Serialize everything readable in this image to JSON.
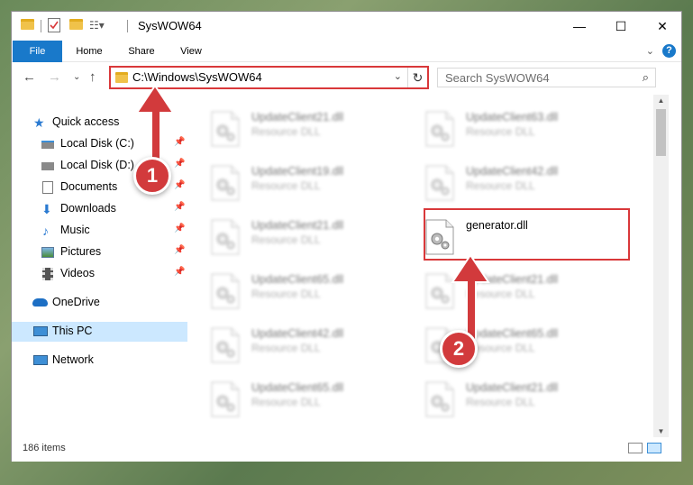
{
  "window": {
    "title": "SysWOW64",
    "controls": {
      "minimize": "—",
      "maximize": "☐",
      "close": "✕"
    }
  },
  "ribbon": {
    "tabs": [
      "File",
      "Home",
      "Share",
      "View"
    ],
    "help": "?"
  },
  "address_bar": {
    "path": "C:\\Windows\\SysWOW64",
    "refresh_icon": "↻"
  },
  "search": {
    "placeholder": "Search SysWOW64"
  },
  "nav_pane": {
    "quick_access": "Quick access",
    "pinned": [
      "Local Disk (C:)",
      "Local Disk (D:)",
      "Documents",
      "Downloads",
      "Music",
      "Pictures",
      "Videos"
    ],
    "onedrive": "OneDrive",
    "this_pc": "This PC",
    "network": "Network"
  },
  "files": [
    {
      "name": "UpdateClient21.dll",
      "type": "Resource DLL"
    },
    {
      "name": "UpdateClient63.dll",
      "type": "Resource DLL"
    },
    {
      "name": "UpdateClient19.dll",
      "type": "Resource DLL"
    },
    {
      "name": "UpdateClient42.dll",
      "type": "Resource DLL"
    },
    {
      "name": "UpdateClient21.dll",
      "type": "Resource DLL"
    },
    {
      "name": "generator.dll",
      "type": ""
    },
    {
      "name": "UpdateClient65.dll",
      "type": "Resource DLL"
    },
    {
      "name": "UpdateClient21.dll",
      "type": "Resource DLL"
    },
    {
      "name": "UpdateClient42.dll",
      "type": "Resource DLL"
    },
    {
      "name": "UpdateClient65.dll",
      "type": "Resource DLL"
    },
    {
      "name": "UpdateClient65.dll",
      "type": "Resource DLL"
    },
    {
      "name": "UpdateClient21.dll",
      "type": "Resource DLL"
    }
  ],
  "status": {
    "item_count": "186 items"
  },
  "callouts": [
    "1",
    "2"
  ],
  "colors": {
    "accent": "#1979ca",
    "highlight": "#d9383a",
    "selected": "#cce8ff"
  }
}
